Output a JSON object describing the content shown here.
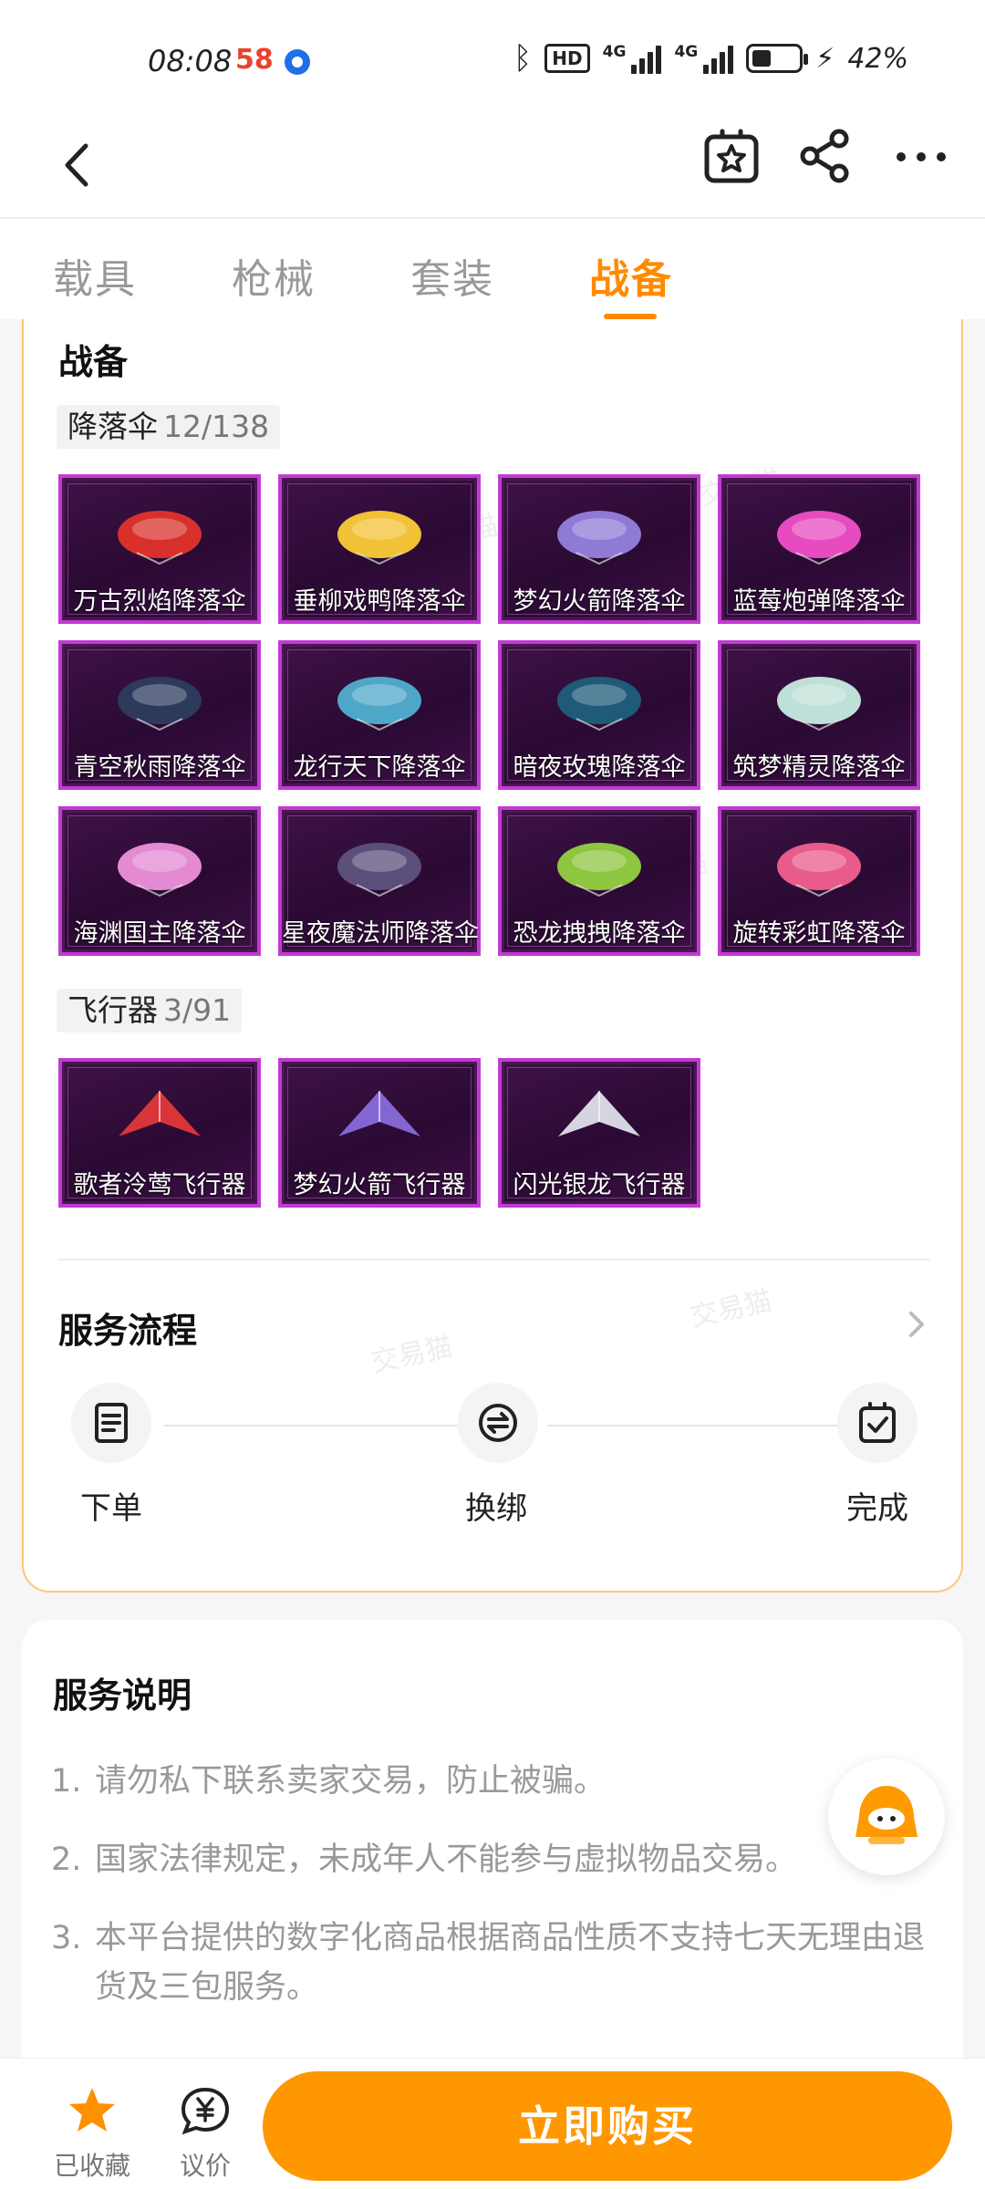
{
  "status_bar": {
    "time": "08:08",
    "app_badge": "58",
    "battery_pct": "42%",
    "battery_level": 0.42,
    "network": "4G"
  },
  "tabs": [
    {
      "label": "载具",
      "active": false
    },
    {
      "label": "枪械",
      "active": false
    },
    {
      "label": "套装",
      "active": false
    },
    {
      "label": "战备",
      "active": true
    }
  ],
  "section": {
    "title": "战备",
    "parachutes": {
      "label": "降落伞",
      "count": "12/138",
      "items": [
        {
          "name": "万古烈焰降落伞",
          "color": "#d9302c"
        },
        {
          "name": "垂柳戏鸭降落伞",
          "color": "#f2c236"
        },
        {
          "name": "梦幻火箭降落伞",
          "color": "#8f7ad6"
        },
        {
          "name": "蓝莓炮弹降落伞",
          "color": "#e64bbf"
        },
        {
          "name": "青空秋雨降落伞",
          "color": "#2d3a5c"
        },
        {
          "name": "龙行天下降落伞",
          "color": "#4fa7c8"
        },
        {
          "name": "暗夜玫瑰降落伞",
          "color": "#1f5a78"
        },
        {
          "name": "筑梦精灵降落伞",
          "color": "#bfe0d8"
        },
        {
          "name": "海渊国主降落伞",
          "color": "#e48ad2"
        },
        {
          "name": "星夜魔法师降落伞",
          "color": "#5b4e7a"
        },
        {
          "name": "恐龙拽拽降落伞",
          "color": "#8ec63f"
        },
        {
          "name": "旋转彩虹降落伞",
          "color": "#e85b8a"
        }
      ]
    },
    "aircraft": {
      "label": "飞行器",
      "count": "3/91",
      "items": [
        {
          "name": "歌者泠莺飞行器",
          "color": "#e83a3a"
        },
        {
          "name": "梦幻火箭飞行器",
          "color": "#8b6fe0"
        },
        {
          "name": "闪光银龙飞行器",
          "color": "#e6e6f0"
        }
      ]
    }
  },
  "service_flow": {
    "title": "服务流程",
    "steps": [
      {
        "label": "下单",
        "icon": "document-icon"
      },
      {
        "label": "换绑",
        "icon": "swap-icon"
      },
      {
        "label": "完成",
        "icon": "check-clipboard-icon"
      }
    ]
  },
  "service_description": {
    "title": "服务说明",
    "items": [
      {
        "n": "1.",
        "text": "请勿私下联系卖家交易，防止被骗。"
      },
      {
        "n": "2.",
        "text": "国家法律规定，未成年人不能参与虚拟物品交易。"
      },
      {
        "n": "3.",
        "text": "本平台提供的数字化商品根据商品性质不支持七天无理由退货及三包服务。"
      }
    ]
  },
  "bottom_bar": {
    "favorite_label": "已收藏",
    "bid_label": "议价",
    "buy_label": "立即购买"
  },
  "watermark": "交易猫",
  "colors": {
    "accent": "#ff8a00",
    "buy": "#ff9700",
    "item_border": "#c13bd2"
  }
}
